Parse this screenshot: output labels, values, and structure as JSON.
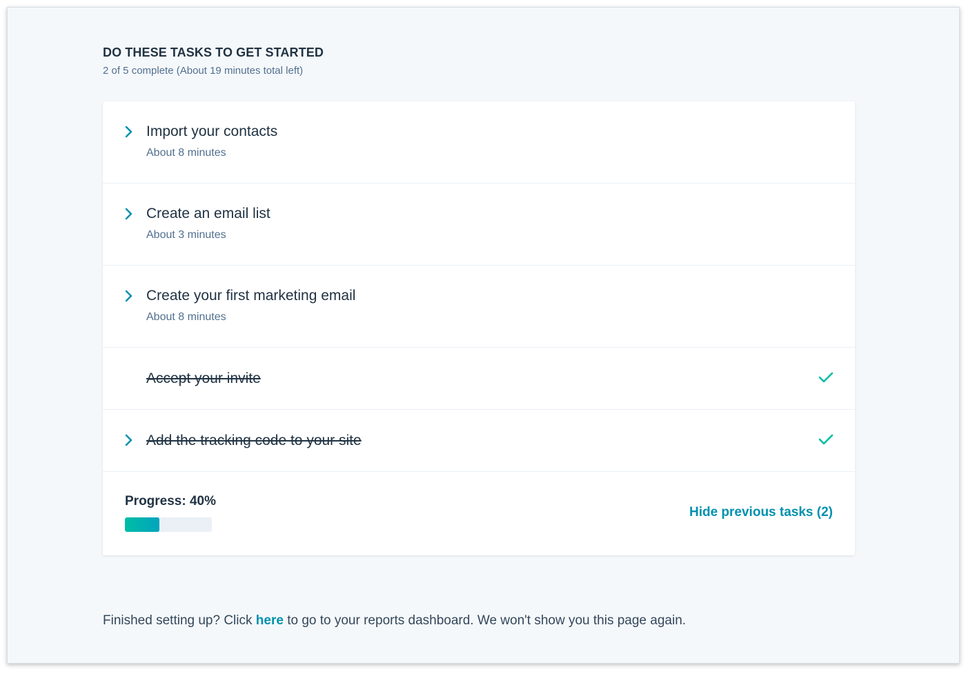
{
  "header": {
    "title": "DO THESE TASKS TO GET STARTED",
    "subtitle": "2 of 5 complete (About 19 minutes total left)"
  },
  "tasks": [
    {
      "title": "Import your contacts",
      "time": "About 8 minutes",
      "completed": false
    },
    {
      "title": "Create an email list",
      "time": "About 3 minutes",
      "completed": false
    },
    {
      "title": "Create your first marketing email",
      "time": "About 8 minutes",
      "completed": false
    },
    {
      "title": "Accept your invite",
      "completed": true
    },
    {
      "title": "Add the tracking code to your site",
      "completed": true
    }
  ],
  "progress": {
    "label": "Progress: 40%",
    "percent": 40
  },
  "hide_link": "Hide previous tasks (2)",
  "footer": {
    "prefix": "Finished setting up? Click ",
    "link": "here",
    "suffix": " to go to your reports dashboard. We won't show you this page again."
  },
  "colors": {
    "accent": "#0091ae",
    "success": "#00bda5",
    "text": "#33475b",
    "background": "#f5f8fa"
  },
  "icons": {
    "chevron": "chevron-right-icon",
    "check": "checkmark-icon"
  }
}
